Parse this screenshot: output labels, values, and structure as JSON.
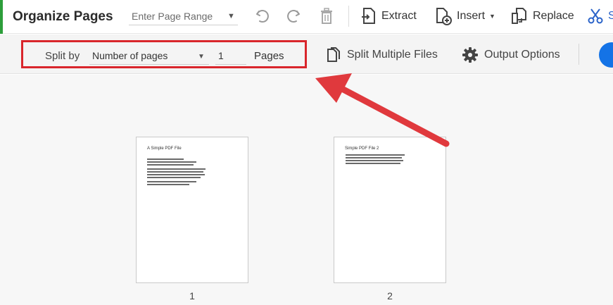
{
  "toolbar": {
    "title": "Organize Pages",
    "page_range_placeholder": "Enter Page Range",
    "extract_label": "Extract",
    "insert_label": "Insert",
    "replace_label": "Replace",
    "split_label_partial": "S",
    "accent_color": "#2d9e3a",
    "link_color": "#2a63c9"
  },
  "split_bar": {
    "split_by_label": "Split by",
    "split_mode": "Number of pages",
    "page_count": "1",
    "pages_unit": "Pages",
    "split_multiple_files_label": "Split Multiple Files",
    "output_options_label": "Output Options",
    "highlight_color": "#d9262c"
  },
  "pages": [
    {
      "heading": "A Simple PDF File",
      "number": "1"
    },
    {
      "heading": "Simple PDF File 2",
      "number": "2"
    }
  ],
  "annotation": {
    "arrow_color": "#e0393d"
  }
}
